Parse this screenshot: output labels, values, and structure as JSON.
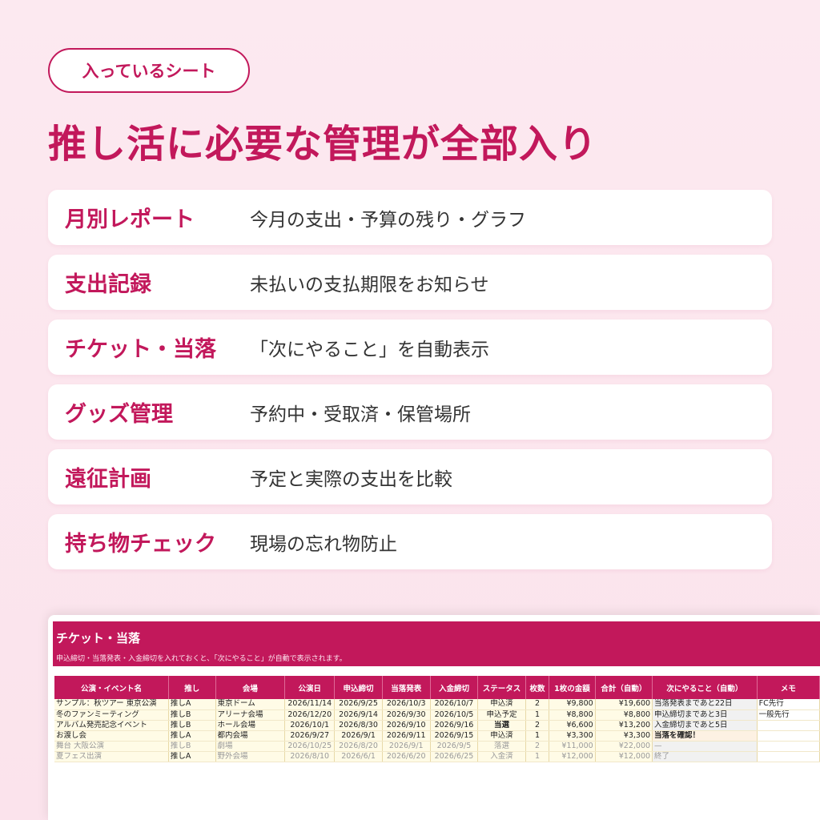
{
  "badge": "入っているシート",
  "headline": "推し活に必要な管理が全部入り",
  "features": [
    {
      "name": "月別レポート",
      "desc": "今月の支出・予算の残り・グラフ"
    },
    {
      "name": "支出記録",
      "desc": "未払いの支払期限をお知らせ"
    },
    {
      "name": "チケット・当落",
      "desc": "「次にやること」を自動表示"
    },
    {
      "name": "グッズ管理",
      "desc": "予約中・受取済・保管場所"
    },
    {
      "name": "遠征計画",
      "desc": "予定と実際の支出を比較"
    },
    {
      "name": "持ち物チェック",
      "desc": "現場の忘れ物防止"
    }
  ],
  "sheet": {
    "title": "チケット・当落",
    "note": "申込締切・当落発表・入金締切を入れておくと、「次にやること」が自動で表示されます。",
    "columns": [
      "公演・イベント名",
      "推し",
      "会場",
      "公演日",
      "申込締切",
      "当落発表",
      "入金締切",
      "ステータス",
      "枚数",
      "1枚の金額",
      "合計（自動）",
      "次にやること（自動）",
      "メモ"
    ],
    "rows": [
      {
        "event": "サンプル：秋ツアー 東京公演",
        "oshi": "推しA",
        "venue": "東京ドーム",
        "date": "2026/11/14",
        "apply": "2026/9/25",
        "result": "2026/10/3",
        "pay": "2026/10/7",
        "status": "申込済",
        "qty": "2",
        "price": "¥9,800",
        "total": "¥19,600",
        "next": "当落発表まであと22日",
        "memo": "FC先行"
      },
      {
        "event": "冬のファンミーティング",
        "oshi": "推しB",
        "venue": "アリーナ会場",
        "date": "2026/12/20",
        "apply": "2026/9/14",
        "result": "2026/9/30",
        "pay": "2026/10/5",
        "status": "申込予定",
        "qty": "1",
        "price": "¥8,800",
        "total": "¥8,800",
        "next": "申込締切まであと3日",
        "memo": "一般先行"
      },
      {
        "event": "アルバム発売記念イベント",
        "oshi": "推しB",
        "venue": "ホール会場",
        "date": "2026/10/1",
        "apply": "2026/8/30",
        "result": "2026/9/10",
        "pay": "2026/9/16",
        "status": "当選",
        "qty": "2",
        "price": "¥6,600",
        "total": "¥13,200",
        "next": "入金締切まであと5日",
        "memo": ""
      },
      {
        "event": "お渡し会",
        "oshi": "推しA",
        "venue": "都内会場",
        "date": "2026/9/27",
        "apply": "2026/9/1",
        "result": "2026/9/11",
        "pay": "2026/9/15",
        "status": "申込済",
        "qty": "1",
        "price": "¥3,300",
        "total": "¥3,300",
        "next": "当落を確認！",
        "memo": ""
      },
      {
        "event": "舞台 大阪公演",
        "oshi": "推しB",
        "venue": "劇場",
        "date": "2026/10/25",
        "apply": "2026/8/20",
        "result": "2026/9/1",
        "pay": "2026/9/5",
        "status": "落選",
        "qty": "2",
        "price": "¥11,000",
        "total": "¥22,000",
        "next": "—",
        "memo": ""
      },
      {
        "event": "夏フェス出演",
        "oshi": "推しA",
        "venue": "野外会場",
        "date": "2026/8/10",
        "apply": "2026/6/1",
        "result": "2026/6/20",
        "pay": "2026/6/25",
        "status": "入金済",
        "qty": "1",
        "price": "¥12,000",
        "total": "¥12,000",
        "next": "終了",
        "memo": ""
      }
    ]
  }
}
